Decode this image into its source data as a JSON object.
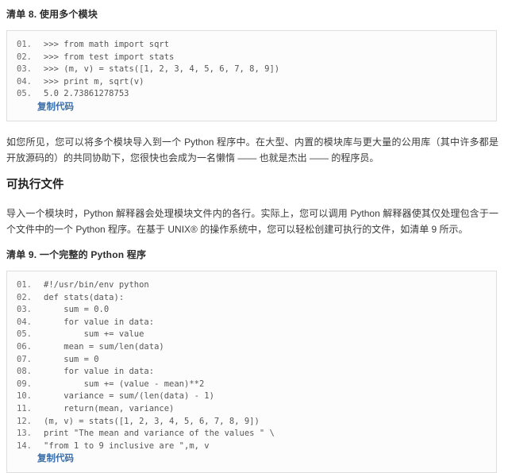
{
  "document": {
    "listing8": {
      "caption": "清单 8. 使用多个模块",
      "lines": [
        {
          "num": "01.",
          "code": ">>> from math import sqrt"
        },
        {
          "num": "02.",
          "code": ">>> from test import stats"
        },
        {
          "num": "03.",
          "code": ">>> (m, v) = stats([1, 2, 3, 4, 5, 6, 7, 8, 9])"
        },
        {
          "num": "04.",
          "code": ">>> print m, sqrt(v)"
        },
        {
          "num": "05.",
          "code": "5.0 2.73861278753"
        }
      ],
      "copy_label": "复制代码"
    },
    "paragraph1": "如您所见，您可以将多个模块导入到一个 Python 程序中。在大型、内置的模块库与更大量的公用库（其中许多都是开放源码的）的共同协助下，您很快也会成为一名懒惰 —— 也就是杰出 —— 的程序员。",
    "heading_executable": "可执行文件",
    "paragraph2": "导入一个模块时，Python 解释器会处理模块文件内的各行。实际上，您可以调用 Python 解释器使其仅处理包含于一个文件中的一个 Python 程序。在基于 UNIX® 的操作系统中，您可以轻松创建可执行的文件，如清单 9 所示。",
    "listing9": {
      "caption": "清单 9. 一个完整的 Python 程序",
      "lines": [
        {
          "num": "01.",
          "code": "#!/usr/bin/env python"
        },
        {
          "num": "02.",
          "code": "def stats(data):"
        },
        {
          "num": "03.",
          "code": "    sum = 0.0"
        },
        {
          "num": "04.",
          "code": "    for value in data:"
        },
        {
          "num": "05.",
          "code": "        sum += value"
        },
        {
          "num": "06.",
          "code": "    mean = sum/len(data)"
        },
        {
          "num": "07.",
          "code": "    sum = 0"
        },
        {
          "num": "08.",
          "code": "    for value in data:"
        },
        {
          "num": "09.",
          "code": "        sum += (value - mean)**2"
        },
        {
          "num": "10.",
          "code": "    variance = sum/(len(data) - 1)"
        },
        {
          "num": "11.",
          "code": "    return(mean, variance)"
        },
        {
          "num": "12.",
          "code": "(m, v) = stats([1, 2, 3, 4, 5, 6, 7, 8, 9])"
        },
        {
          "num": "13.",
          "code": "print \"The mean and variance of the values \" \\"
        },
        {
          "num": "14.",
          "code": "\"from 1 to 9 inclusive are \",m, v"
        }
      ],
      "copy_label": "复制代码"
    }
  },
  "colors": {
    "link": "#3b6ea8",
    "code_border": "#dedede",
    "code_bg": "#fcfcfc",
    "text": "#333333"
  }
}
